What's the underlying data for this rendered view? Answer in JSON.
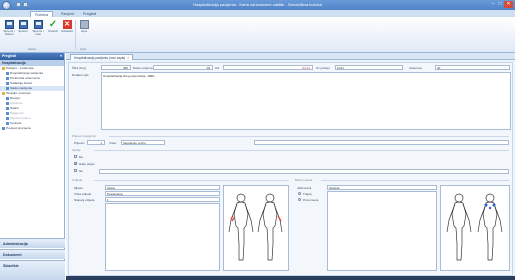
{
  "window": {
    "title": "Hospitalizacija pacijenta - Karta zdravstvene zaštite - Sveučilišna bolnica",
    "minimize": "–",
    "maximize": "□",
    "close": "✕"
  },
  "ribbon": {
    "tabs": [
      "Početna",
      "Pacijent",
      "Pregledi"
    ],
    "active_tab": 0,
    "buttons": [
      {
        "label": "Spremi i zatvori",
        "icon": "save-close-icon"
      },
      {
        "label": "Spremi",
        "icon": "save-icon"
      },
      {
        "label": "Spremi i novi",
        "icon": "save-new-icon"
      },
      {
        "label": "Potvrdi",
        "icon": "confirm-icon"
      },
      {
        "label": "Odustani",
        "icon": "cancel-icon"
      },
      {
        "label": "Ispis",
        "icon": "print-icon"
      }
    ],
    "groups": [
      "Akcije",
      "Ispis"
    ]
  },
  "nav": {
    "header": "Pregledi",
    "pin": "▾",
    "subheader": "Hospitalizacija",
    "tree": [
      {
        "label": "Pacijent - evidencija",
        "level": 0,
        "icon": "folder-icon",
        "selected": false,
        "dim": false
      },
      {
        "label": "Hospitalizacija pacijenta",
        "level": 1,
        "icon": "doc-icon",
        "selected": false,
        "dim": false
      },
      {
        "label": "Prethodna anamneza",
        "level": 1,
        "icon": "doc-icon",
        "selected": false,
        "dim": false
      },
      {
        "label": "Sadašnja bolest",
        "level": 1,
        "icon": "doc-icon",
        "selected": false,
        "dim": false
      },
      {
        "label": "Status pacijenta",
        "level": 1,
        "icon": "doc-icon",
        "selected": true,
        "dim": false
      },
      {
        "label": "Terapija i postupci",
        "level": 0,
        "icon": "folder-icon",
        "selected": false,
        "dim": false
      },
      {
        "label": "Recept",
        "level": 1,
        "icon": "doc-icon",
        "selected": false,
        "dim": false
      },
      {
        "label": "Uputnica",
        "level": 1,
        "icon": "doc-icon",
        "selected": false,
        "dim": true
      },
      {
        "label": "Nalazi",
        "level": 1,
        "icon": "doc-icon",
        "selected": false,
        "dim": false
      },
      {
        "label": "Dijagnoze",
        "level": 1,
        "icon": "doc-icon",
        "selected": false,
        "dim": true
      },
      {
        "label": "Otpusno pismo",
        "level": 1,
        "icon": "doc-icon",
        "selected": false,
        "dim": true
      },
      {
        "label": "Kontrole",
        "level": 1,
        "icon": "doc-icon",
        "selected": false,
        "dim": false
      },
      {
        "label": "Povijest promjena",
        "level": 0,
        "icon": "doc-icon",
        "selected": false,
        "dim": false
      }
    ],
    "bottom": [
      "Administracija",
      "Dokumenti",
      "Skladište"
    ]
  },
  "doc_tab": {
    "label": "Hospitalizacija pacijenta (novi zapis)",
    "close": "×"
  },
  "form": {
    "row1": {
      "l1": "Šifra (broj)",
      "v1": "456",
      "l2": "Datum prijema",
      "v2": "08",
      "l3": "Od",
      "v3": "01.01",
      "l4": "Uz pratnju",
      "v4": "1024",
      "l5": "Ustanova",
      "v5": "40"
    },
    "row2": {
      "label": "Dodatni opis",
      "value": "Hospitalizacija zbog opservacije, 1998. ..."
    },
    "section_transport": "Prijevoz pacijenta",
    "transport": {
      "label": "Prijevoz",
      "v1": "1",
      "l2": "Vrsta",
      "v2": "Sanitetsko vozilo"
    },
    "section_flags": "Opcije",
    "flags": [
      {
        "label": "Da",
        "on": false
      },
      {
        "label": "Hitan prijem",
        "on": true
      },
      {
        "label": "Ne",
        "on": false
      }
    ],
    "left_panel": {
      "section": "Ozljede",
      "rows": [
        {
          "label": "Mjesto",
          "value": "Glava"
        },
        {
          "label": "Vrsta ozljede",
          "value": "Posjekotina"
        },
        {
          "label": "Stupanj ozljede",
          "value": "1"
        }
      ]
    },
    "right_panel": {
      "section": "Bolna mjesta",
      "rows": [
        {
          "label": "Jačina boli",
          "value": "Srednja"
        }
      ],
      "options": [
        {
          "label": "Trajna",
          "on": true
        },
        {
          "label": "Povremena",
          "on": false
        }
      ]
    }
  },
  "colors": {
    "accent": "#2f5f9f",
    "injury": "#d33a2e",
    "pain": "#2f5fcf"
  }
}
